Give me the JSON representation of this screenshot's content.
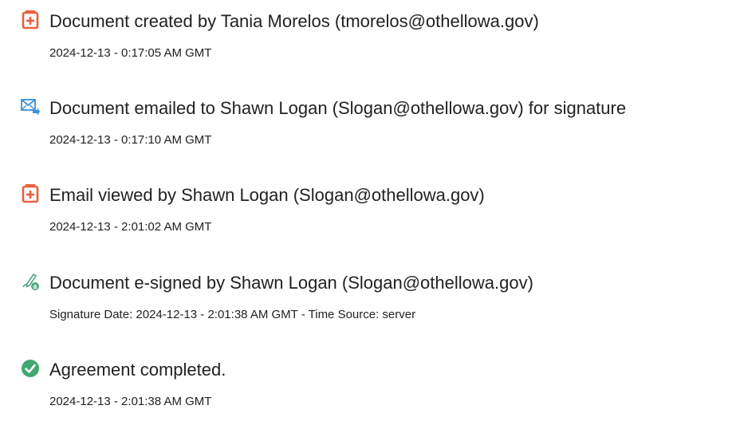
{
  "colors": {
    "pdf_icon": "#e8613c",
    "email_icon": "#3b8fd8",
    "sign_icon": "#4fa882",
    "complete_icon": "#3fa870",
    "text": "#222222"
  },
  "events": [
    {
      "icon": "document-icon",
      "title": "Document created by Tania Morelos (tmorelos@othellowa.gov)",
      "meta": "2024-12-13 - 0:17:05 AM GMT"
    },
    {
      "icon": "email-sent-icon",
      "title": "Document emailed to Shawn Logan (Slogan@othellowa.gov) for signature",
      "meta": "2024-12-13 - 0:17:10 AM GMT"
    },
    {
      "icon": "document-icon",
      "title": "Email viewed by Shawn Logan (Slogan@othellowa.gov)",
      "meta": "2024-12-13 - 2:01:02 AM GMT"
    },
    {
      "icon": "e-sign-pen-icon",
      "title": "Document e-signed by Shawn Logan (Slogan@othellowa.gov)",
      "meta": "Signature Date: 2024-12-13 - 2:01:38 AM GMT - Time Source: server"
    },
    {
      "icon": "check-circle-icon",
      "title": "Agreement completed.",
      "meta": "2024-12-13 - 2:01:38 AM GMT"
    }
  ]
}
